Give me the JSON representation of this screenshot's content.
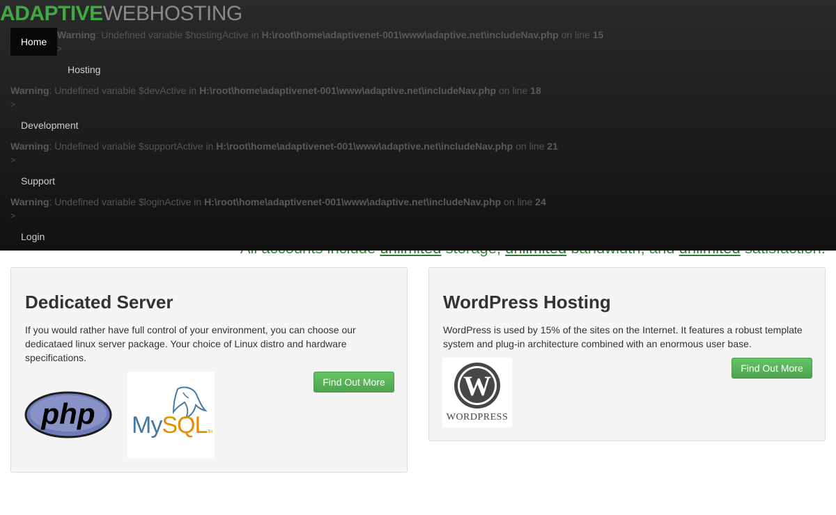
{
  "brand": {
    "part1": "ADAPTIVE",
    "part2": "WEBHOSTING"
  },
  "nav": {
    "home": "Home",
    "hosting": "Hosting",
    "development": "Development",
    "support": "Support",
    "login": "Login",
    "arrow": ">"
  },
  "warnings": [
    {
      "label": "Warning",
      "msg": ": Undefined variable $hostingActive in ",
      "path": "H:\\root\\home\\adaptivenet-001\\www\\adaptive.net\\includeNav.php",
      "online": " on line ",
      "line": "15"
    },
    {
      "label": "Warning",
      "msg": ": Undefined variable $devActive in ",
      "path": "H:\\root\\home\\adaptivenet-001\\www\\adaptive.net\\includeNav.php",
      "online": " on line ",
      "line": "18"
    },
    {
      "label": "Warning",
      "msg": ": Undefined variable $supportActive in ",
      "path": "H:\\root\\home\\adaptivenet-001\\www\\adaptive.net\\includeNav.php",
      "online": " on line ",
      "line": "21"
    },
    {
      "label": "Warning",
      "msg": ": Undefined variable $loginActive in ",
      "path": "H:\\root\\home\\adaptivenet-001\\www\\adaptive.net\\includeNav.php",
      "online": " on line ",
      "line": "24"
    }
  ],
  "tagline": {
    "t1": "All accounts include ",
    "u1": "unlimited",
    "t2": " storage, ",
    "u2": "unlimited",
    "t3": " bandwidth, and ",
    "u3": "unlimited",
    "t4": " satisfaction."
  },
  "panels": {
    "dedicated": {
      "title": "Dedicated Server",
      "body": "If you would rather have full control of your environment, you can choose our dedicataed linux server package.  Your choice of Linux distro and hardware specifications.",
      "button": "Find Out More",
      "php_logo": "php",
      "mysql_logo_my": "My",
      "mysql_logo_sql": "SQL",
      "mysql_tm": "TM"
    },
    "wordpress": {
      "title": "WordPress Hosting",
      "body": "WordPress is used by 15% of the sites on the Internet.  It features a robust template system and plug-in architecture combined with an enormous user base.",
      "button": "Find Out More",
      "wp_logo_text": "WORDPRESS"
    }
  },
  "colors": {
    "accent_green": "#3fa943",
    "button_green": "#5cb85c",
    "nav_bg": "#1a1a1a"
  }
}
